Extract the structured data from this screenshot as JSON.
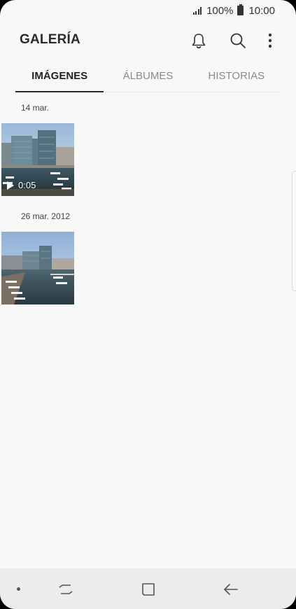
{
  "status_bar": {
    "battery": "100%",
    "time": "10:00"
  },
  "app_bar": {
    "title": "GALERÍA"
  },
  "tabs": [
    {
      "label": "IMÁGENES",
      "active": true
    },
    {
      "label": "ÁLBUMES",
      "active": false
    },
    {
      "label": "HISTORIAS",
      "active": false
    }
  ],
  "groups": [
    {
      "date": "14 mar.",
      "items": [
        {
          "type": "video",
          "duration": "0:05"
        }
      ]
    },
    {
      "date": "26 mar. 2012",
      "items": [
        {
          "type": "image"
        }
      ]
    }
  ],
  "icons": {
    "notifications": "bell-icon",
    "search": "search-icon",
    "more": "more-options-icon",
    "nav_recent": "recent-apps-icon",
    "nav_home": "home-icon",
    "nav_back": "back-icon"
  }
}
